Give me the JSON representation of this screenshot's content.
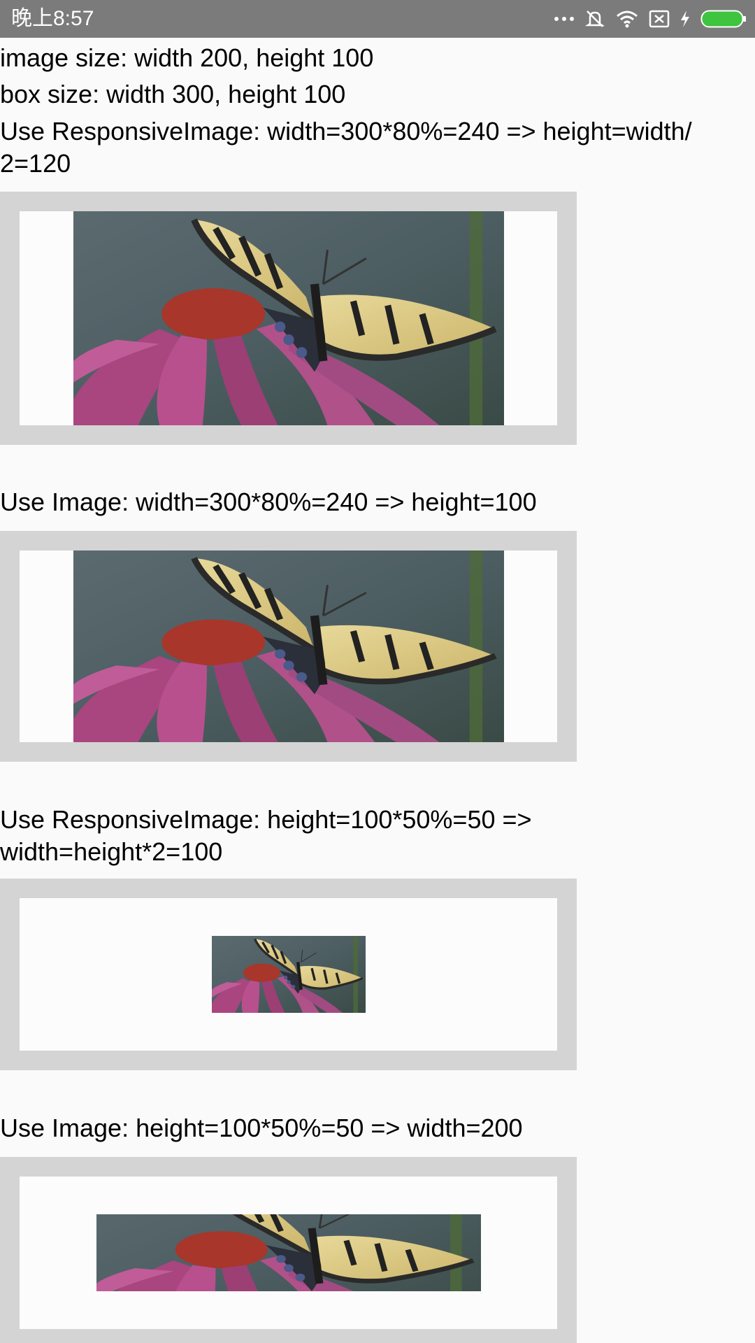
{
  "status_bar": {
    "time": "晚上8:57",
    "icons": [
      "more-dots-icon",
      "mute-icon",
      "wifi-icon",
      "sim-x-icon",
      "charging-bolt-icon",
      "battery-icon"
    ],
    "bar_color": "#7b7b7b",
    "battery_color": "#3ec43e"
  },
  "content": {
    "info_image_size": "image size: width 200, height 100",
    "info_box_size": "box size: width 300, height 100",
    "section1_line1": "Use ResponsiveImage: width=300*80%=240 => height=width/",
    "section1_line2": "2=120",
    "section2_label": "Use Image: width=300*80%=240 => height=100",
    "section3_line1": "Use ResponsiveImage: height=100*50%=50 =>",
    "section3_line2": "width=height*2=100",
    "section4_label": "Use Image: height=100*50%=50 => width=200"
  },
  "image": {
    "subject": "butterfly-on-flower-photo"
  },
  "colors": {
    "frame": "#d4d4d4",
    "box": "#fcfcfc",
    "background": "#fafafa"
  }
}
